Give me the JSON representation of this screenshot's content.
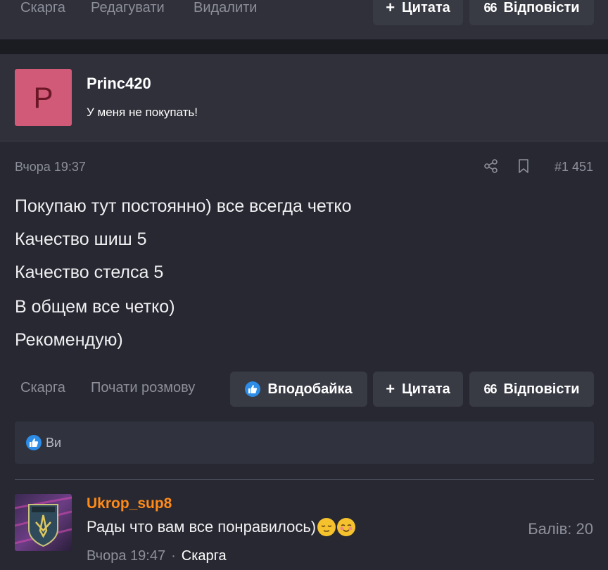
{
  "prev_post_actions": {
    "report": "Скарга",
    "edit": "Редагувати",
    "delete": "Видалити",
    "quote": "Цитата",
    "reply": "Відповісти"
  },
  "author": {
    "avatar_letter": "P",
    "name": "Princ420",
    "title": "У меня не покупать!"
  },
  "post": {
    "date": "Вчора 19:37",
    "number": "#1 451",
    "lines": [
      "Покупаю тут постоянно) все всегда четко",
      "Качество шиш 5",
      "Качество стелса 5",
      "В общем все четко)",
      "Рекомендую)"
    ]
  },
  "post_actions": {
    "report": "Скарга",
    "start_conversation": "Почати розмову",
    "like": "Вподобайка",
    "quote": "Цитата",
    "reply": "Відповісти"
  },
  "reactions": {
    "text": "Ви"
  },
  "reply": {
    "author": "Ukrop_sup8",
    "text": "Рады что вам все понравилось)",
    "score": "Балів: 20",
    "date": "Вчора 19:47",
    "separator": "·",
    "report": "Скарга"
  },
  "colors": {
    "background": "#272831",
    "panel": "#2f3039",
    "button": "#383a44",
    "accent_like": "#2c8ce6",
    "username_orange": "#ff8a18",
    "avatar_pink": "#d05a78"
  }
}
